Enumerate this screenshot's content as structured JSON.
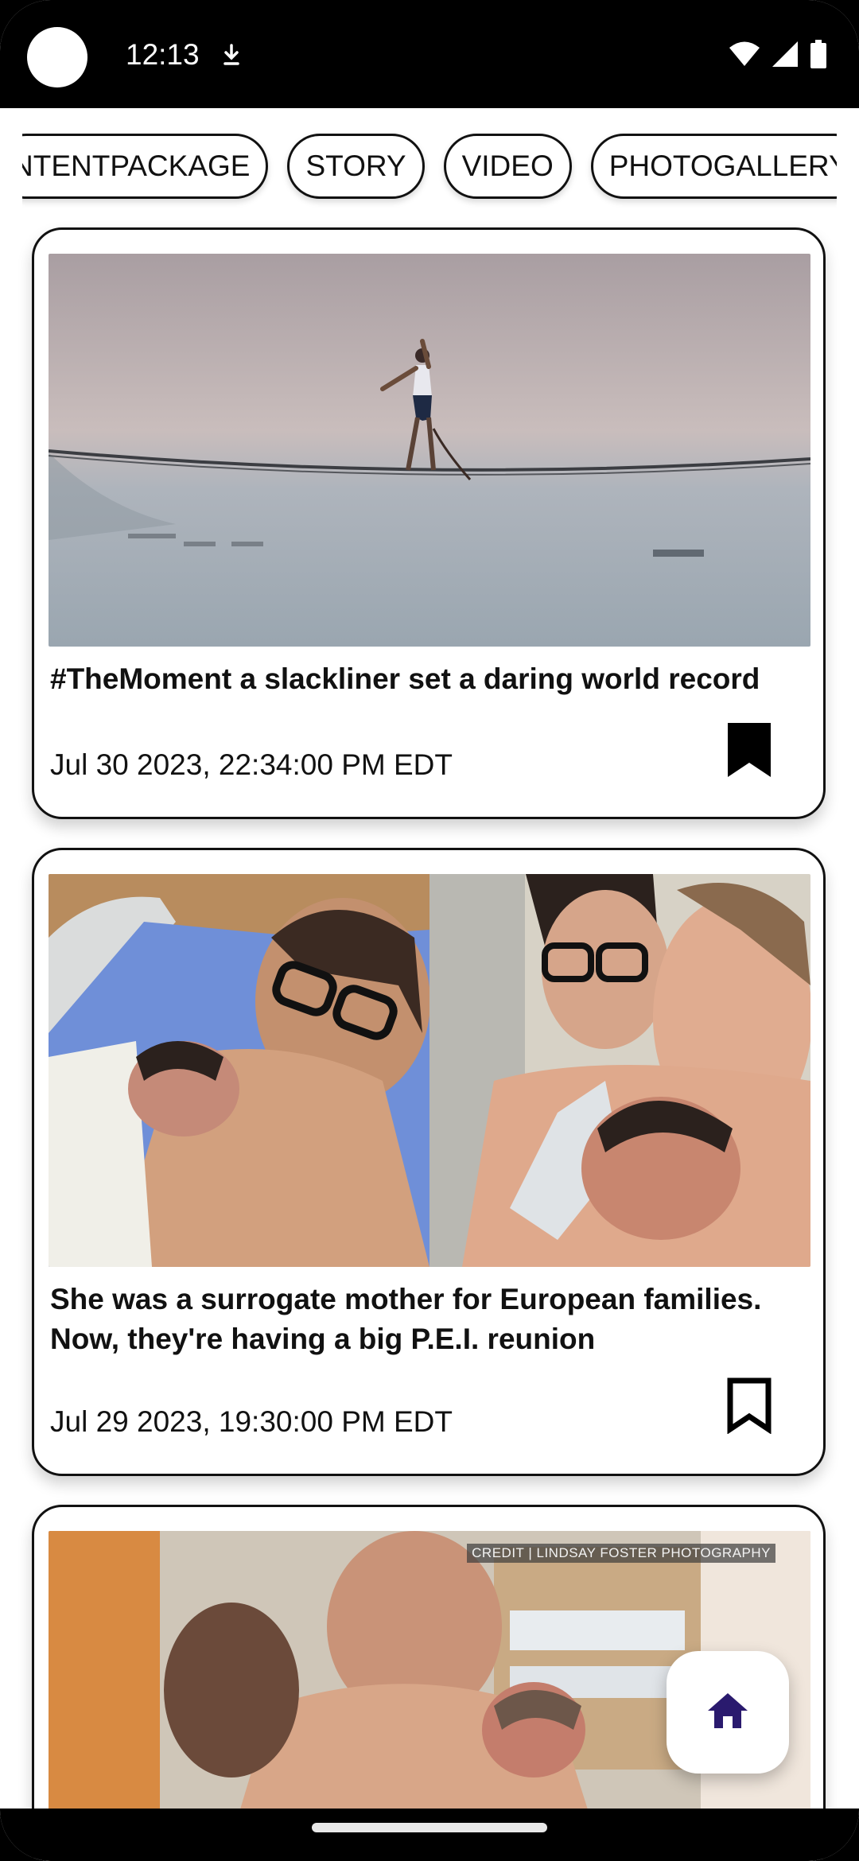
{
  "status_bar": {
    "time": "12:13"
  },
  "filters": {
    "chips": [
      "NTENTPACKAGE",
      "STORY",
      "VIDEO",
      "PHOTOGALLERY"
    ]
  },
  "cards": [
    {
      "title": "#TheMoment a slackliner set a daring world record",
      "date": "Jul 30 2023, 22:34:00 PM EDT",
      "bookmarked": true
    },
    {
      "title": "She was a surrogate mother for European families. Now, they're having a big P.E.I. reunion",
      "date": "Jul 29 2023, 19:30:00 PM EDT",
      "bookmarked": false
    },
    {
      "image_caption": "CREDIT | LINDSAY FOSTER PHOTOGRAPHY"
    }
  ],
  "icons": {
    "status_left": "download-icon",
    "status_right": [
      "wifi-icon",
      "signal-icon",
      "battery-icon"
    ],
    "fab": "home-icon",
    "bookmark": "bookmark-icon"
  },
  "colors": {
    "fab_icon": "#2a1a6e",
    "bar": "#000000"
  }
}
